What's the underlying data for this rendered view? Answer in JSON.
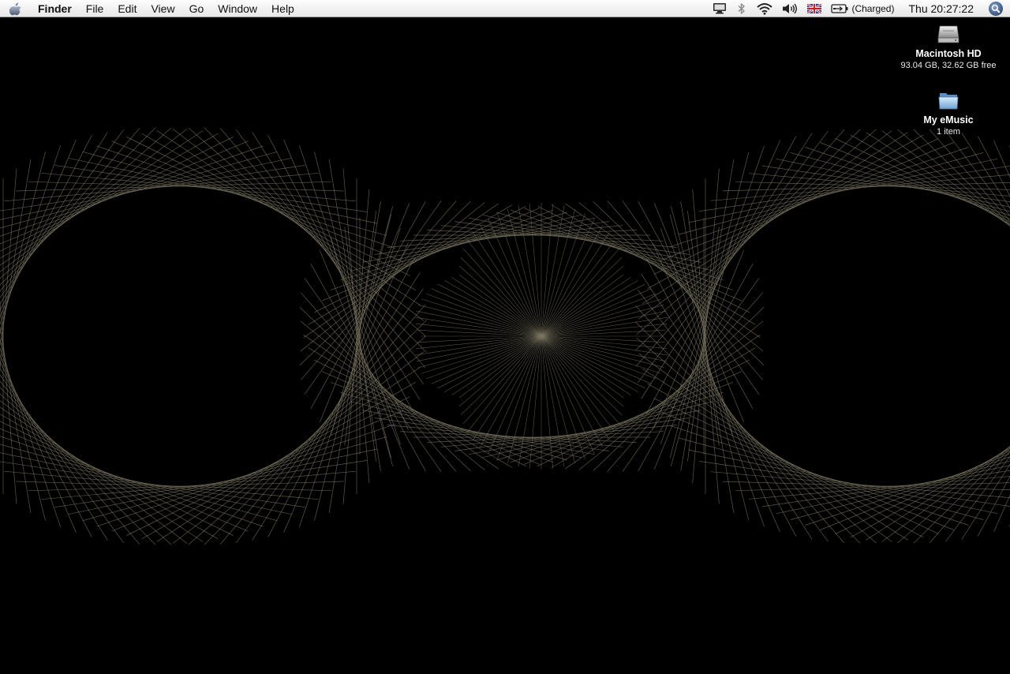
{
  "menubar": {
    "apple_icon": "apple-logo",
    "app_name": "Finder",
    "items": [
      "File",
      "Edit",
      "View",
      "Go",
      "Window",
      "Help"
    ],
    "status_icons": [
      "display-mirror-icon",
      "bluetooth-icon",
      "wifi-icon",
      "volume-icon",
      "uk-flag-input-icon",
      "battery-icon"
    ],
    "battery_status": "(Charged)",
    "clock": "Thu 20:27:22",
    "spotlight_icon": "spotlight-search-icon"
  },
  "desktop": {
    "background_color": "#000000",
    "line_color": "#7a7460",
    "icons": [
      {
        "name": "Macintosh HD",
        "subtitle": "93.04 GB, 32.62 GB free",
        "icon": "hard-drive-icon"
      },
      {
        "name": "My eMusic",
        "subtitle": "1 item",
        "icon": "folder-icon"
      }
    ]
  }
}
